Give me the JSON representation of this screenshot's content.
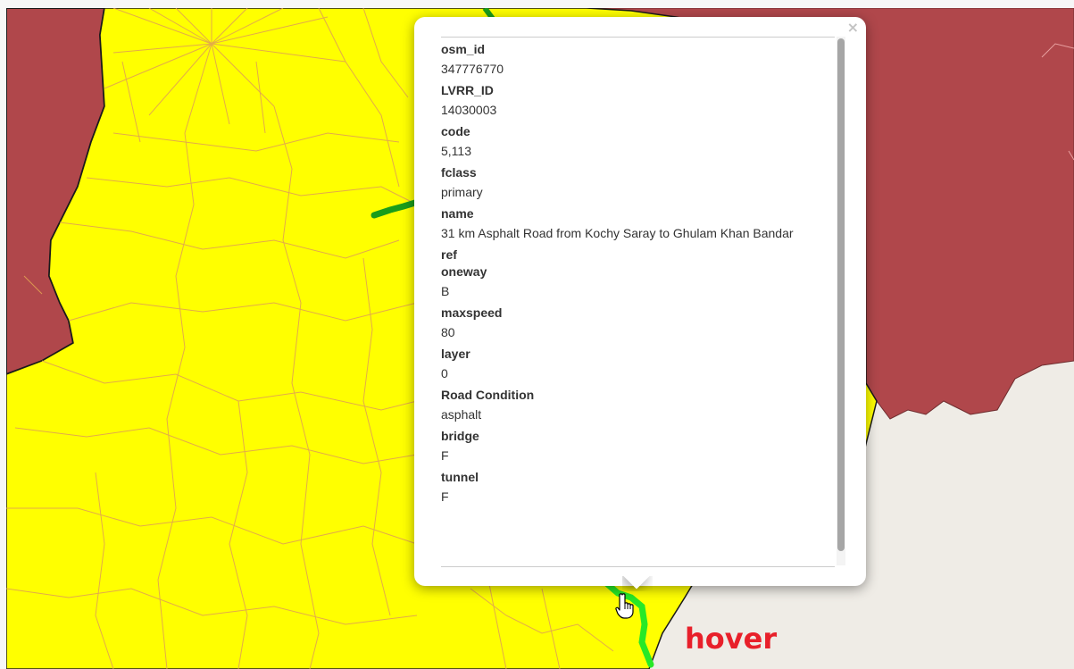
{
  "map": {
    "colors": {
      "highlight_region": "#ffff00",
      "neighbor_region": "#b0474b",
      "background": "#efece6",
      "roads": "#e0a252",
      "selected_road": "#1a9d1a",
      "hovered_road": "#27e827"
    }
  },
  "popup": {
    "close_icon": "×",
    "attributes": [
      {
        "name": "osm_id",
        "value": "347776770"
      },
      {
        "name": "LVRR_ID",
        "value": "14030003"
      },
      {
        "name": "code",
        "value": "5,113"
      },
      {
        "name": "fclass",
        "value": "primary"
      },
      {
        "name": "name",
        "value": "31 km Asphalt Road from Kochy Saray to Ghulam Khan Bandar"
      },
      {
        "name": "ref",
        "value": ""
      },
      {
        "name": "oneway",
        "value": "B"
      },
      {
        "name": "maxspeed",
        "value": "80"
      },
      {
        "name": "layer",
        "value": "0"
      },
      {
        "name": "Road Condition",
        "value": "asphalt"
      },
      {
        "name": "bridge",
        "value": "F"
      },
      {
        "name": "tunnel",
        "value": "F"
      }
    ]
  },
  "annotation": {
    "label": "hover",
    "cursor_icon": "hand-pointer-icon"
  }
}
